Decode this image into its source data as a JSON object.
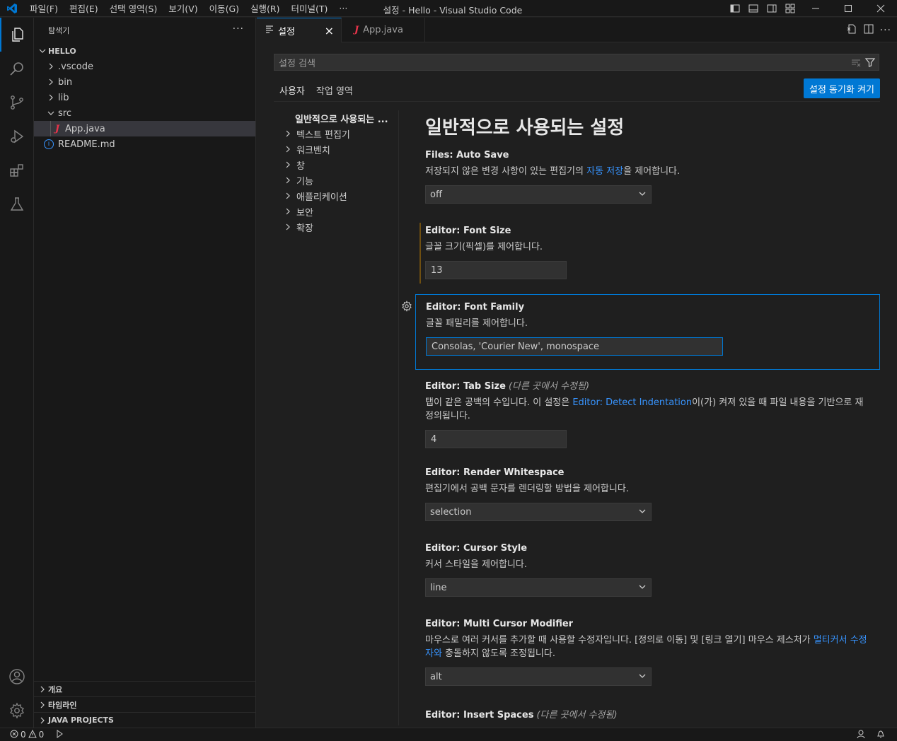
{
  "titlebar": {
    "menu": [
      "파일(F)",
      "편집(E)",
      "선택 영역(S)",
      "보기(V)",
      "이동(G)",
      "실행(R)",
      "터미널(T)",
      "···"
    ],
    "title": "설정 - Hello - Visual Studio Code"
  },
  "activitybar": [
    "explorer-icon",
    "search-icon",
    "source-control-icon",
    "run-debug-icon",
    "extensions-icon",
    "testing-icon",
    "accounts-icon",
    "manage-gear-icon"
  ],
  "explorer": {
    "header": "탐색기",
    "more": "···",
    "root": "HELLO",
    "items": [
      {
        "label": ".vscode",
        "kind": "folder-collapsed",
        "depth": 1
      },
      {
        "label": "bin",
        "kind": "folder-collapsed",
        "depth": 1
      },
      {
        "label": "lib",
        "kind": "folder-collapsed",
        "depth": 1
      },
      {
        "label": "src",
        "kind": "folder-expanded",
        "depth": 1
      },
      {
        "label": "App.java",
        "kind": "java-file",
        "depth": 2,
        "selected": true
      },
      {
        "label": "README.md",
        "kind": "info-file",
        "depth": 1
      }
    ],
    "sections": [
      "개요",
      "타임라인",
      "JAVA PROJECTS"
    ]
  },
  "tabs": [
    {
      "label": "설정",
      "active": true,
      "close": "×"
    },
    {
      "label": "App.java",
      "active": false,
      "prefix": "J"
    }
  ],
  "settings": {
    "search_placeholder": "설정 검색",
    "scopes": [
      "사용자",
      "작업 영역"
    ],
    "sync_button": "설정 동기화 켜기",
    "toc": [
      "일반적으로 사용되는 ...",
      "텍스트 편집기",
      "워크벤치",
      "창",
      "기능",
      "애플리케이션",
      "보안",
      "확장"
    ],
    "group_title": "일반적으로 사용되는 설정",
    "items": [
      {
        "category": "Files: ",
        "name": "Auto Save",
        "desc_pre": "저장되지 않은 변경 사항이 있는 편집기의 ",
        "desc_link": "자동 저장",
        "desc_post": "을 제어합니다.",
        "control": "dropdown",
        "value": "off"
      },
      {
        "category": "Editor: ",
        "name": "Font Size",
        "desc_pre": "글꼴 크기(픽셀)를 제어합니다.",
        "control": "text",
        "value": "13"
      },
      {
        "category": "Editor: ",
        "name": "Font Family",
        "desc_pre": "글꼴 패밀리를 제어합니다.",
        "control": "text",
        "value": "Consolas, 'Courier New', monospace"
      },
      {
        "category": "Editor: ",
        "name": "Tab Size",
        "modified_note": "(다른 곳에서 수정됨)",
        "desc_pre": "탭이 같은 공백의 수입니다. 이 설정은 ",
        "desc_link": "Editor: Detect Indentation",
        "desc_post": "이(가) 켜져 있을 때 파일 내용을 기반으로 재정의됩니다.",
        "control": "text",
        "value": "4"
      },
      {
        "category": "Editor: ",
        "name": "Render Whitespace",
        "desc_pre": "편집기에서 공백 문자를 렌더링할 방법을 제어합니다.",
        "control": "dropdown",
        "value": "selection"
      },
      {
        "category": "Editor: ",
        "name": "Cursor Style",
        "desc_pre": "커서 스타일을 제어합니다.",
        "control": "dropdown",
        "value": "line"
      },
      {
        "category": "Editor: ",
        "name": "Multi Cursor Modifier",
        "desc_pre": "마우스로 여러 커서를 추가할 때 사용할 수정자입니다. [정의로 이동] 및 [링크 열기] 마우스 제스처가 ",
        "desc_link": "멀티커서 수정자와",
        "desc_post": " 충돌하지 않도록 조정됩니다.",
        "control": "dropdown",
        "value": "alt"
      },
      {
        "category": "Editor: ",
        "name": "Insert Spaces",
        "modified_note": "(다른 곳에서 수정됨)"
      }
    ]
  },
  "statusbar": {
    "errors": "0",
    "warnings": "0"
  },
  "colors": {
    "accent": "#0078d4",
    "link": "#3794ff",
    "java": "#e8344a"
  }
}
